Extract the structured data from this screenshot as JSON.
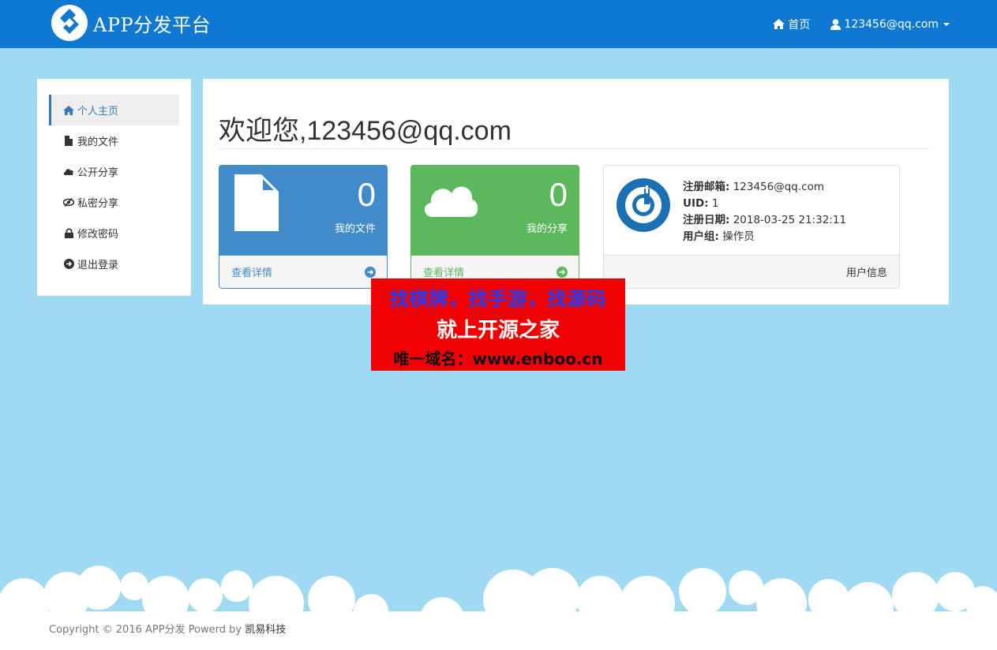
{
  "navbar": {
    "brand": "APP分发平台",
    "home_label": "首页",
    "user_label": "123456@qq.com"
  },
  "sidebar": {
    "items": [
      {
        "label": "个人主页",
        "icon": "home-icon"
      },
      {
        "label": "我的文件",
        "icon": "file-icon"
      },
      {
        "label": "公开分享",
        "icon": "cloud-icon"
      },
      {
        "label": "私密分享",
        "icon": "eye-slash-icon"
      },
      {
        "label": "修改密码",
        "icon": "lock-icon"
      },
      {
        "label": "退出登录",
        "icon": "logout-icon"
      }
    ]
  },
  "main": {
    "welcome": "欢迎您,123456@qq.com",
    "cards": [
      {
        "count": "0",
        "label": "我的文件",
        "link": "查看详情",
        "color": "#428bca"
      },
      {
        "count": "0",
        "label": "我的分享",
        "link": "查看详情",
        "color": "#5cb85c"
      }
    ],
    "user": {
      "email_label": "注册邮箱:",
      "email": "123456@qq.com",
      "uid_label": "UID:",
      "uid": "1",
      "date_label": "注册日期:",
      "date": "2018-03-25 21:32:11",
      "group_label": "用户组:",
      "group": "操作员",
      "footer": "用户信息"
    }
  },
  "ad": {
    "line1": "找棋牌，找手游，找源码",
    "line2": "就上开源之家",
    "line3": "唯一域名：www.enboo.cn"
  },
  "footer": {
    "text": "Copyright © 2016 APP分发 Powerd by ",
    "company": "凯易科技"
  }
}
